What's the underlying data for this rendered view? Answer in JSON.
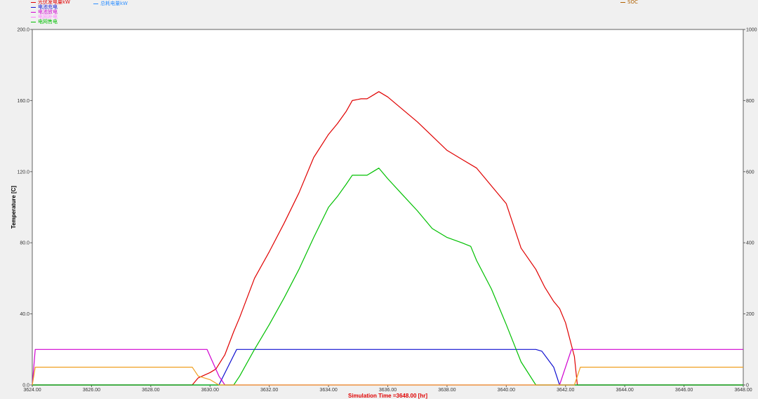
{
  "chart_data": {
    "type": "line",
    "xlabel": "Simulation Time =3648.00 [hr]",
    "ylabel": "Temperature [C]",
    "xlim": [
      3624,
      3648
    ],
    "ylim": [
      0,
      200
    ],
    "y2lim": [
      0,
      1000
    ],
    "x_ticks": [
      "3624.00",
      "3626.00",
      "3628.00",
      "3630.00",
      "3632.00",
      "3634.00",
      "3636.00",
      "3638.00",
      "3640.00",
      "3642.00",
      "3644.00",
      "3646.00",
      "3648.00"
    ],
    "y_ticks": [
      "0.0",
      "40.0",
      "80.0",
      "120.0",
      "160.0",
      "200.0"
    ],
    "y2_ticks": [
      "0",
      "200",
      "400",
      "600",
      "800",
      "1000"
    ],
    "legend_left": [
      {
        "name": "光伏发电量kW",
        "color": "#e00000"
      },
      {
        "name": "电池充电",
        "color": "#1010d0"
      },
      {
        "name": "电池放电",
        "color": "#d000d0"
      },
      {
        "name": "电网补电",
        "color": "#ff80ff"
      },
      {
        "name": "电网售电",
        "color": "#00c000"
      }
    ],
    "legend_mid": [
      {
        "name": "总耗电量kW",
        "color": "#3090ff"
      }
    ],
    "legend_right": [
      {
        "name": "SOC",
        "color": "#b06000"
      }
    ],
    "series": [
      {
        "name": "光伏发电量kW",
        "color": "#e00000",
        "axis": "left",
        "x": [
          3624,
          3629.4,
          3629.6,
          3630,
          3630.2,
          3630.5,
          3630.8,
          3631,
          3631.5,
          3632,
          3632.5,
          3633,
          3633.5,
          3634,
          3634.3,
          3634.6,
          3634.8,
          3635.1,
          3635.3,
          3635.5,
          3635.7,
          3636,
          3636.5,
          3637,
          3637.5,
          3638,
          3638.5,
          3639,
          3639.5,
          3640,
          3640.5,
          3641,
          3641.3,
          3641.6,
          3641.8,
          3642,
          3642.3,
          3642.4,
          3648
        ],
        "y": [
          0,
          0,
          4,
          7,
          9,
          17,
          30,
          38,
          60,
          75,
          91,
          108,
          128,
          141,
          147,
          154,
          160,
          161,
          161,
          163,
          165,
          162,
          155,
          148,
          140,
          132,
          127,
          122,
          112,
          102,
          77,
          65,
          55,
          47,
          43,
          35,
          16,
          0,
          0
        ]
      },
      {
        "name": "电池充电",
        "color": "#1010d0",
        "axis": "left",
        "x": [
          3624,
          3630.3,
          3630.9,
          3641,
          3641.2,
          3641.6,
          3641.8,
          3648
        ],
        "y": [
          0,
          0,
          20,
          20,
          19,
          10,
          0,
          0
        ]
      },
      {
        "name": "电池放电",
        "color": "#d000d0",
        "axis": "left",
        "x": [
          3624,
          3624.1,
          3629.9,
          3630.3,
          3630.5,
          3641.8,
          3642.2,
          3648
        ],
        "y": [
          0,
          20,
          20,
          5,
          0,
          0,
          20,
          20
        ]
      },
      {
        "name": "电网售电",
        "color": "#00c000",
        "axis": "left",
        "x": [
          3624,
          3630.8,
          3631,
          3631.5,
          3632,
          3632.5,
          3633,
          3633.5,
          3634,
          3634.3,
          3634.6,
          3634.8,
          3635,
          3635.3,
          3635.5,
          3635.7,
          3636,
          3636.5,
          3637,
          3637.5,
          3638,
          3638.5,
          3638.8,
          3639,
          3639.5,
          3640,
          3640.5,
          3641,
          3648
        ],
        "y": [
          0,
          0,
          5,
          20,
          34,
          49,
          65,
          83,
          100,
          106,
          113,
          118,
          118,
          118,
          120,
          122,
          116,
          107,
          98,
          88,
          83,
          80,
          78,
          70,
          54,
          34,
          13,
          0,
          0
        ]
      },
      {
        "name": "SOC",
        "color": "#f0a020",
        "axis": "left",
        "x": [
          3624,
          3624.1,
          3629.4,
          3629.6,
          3630,
          3630.3,
          3642.3,
          3642.5,
          3648
        ],
        "y": [
          0,
          10,
          10,
          5,
          3,
          0,
          0,
          10,
          10
        ]
      }
    ]
  }
}
